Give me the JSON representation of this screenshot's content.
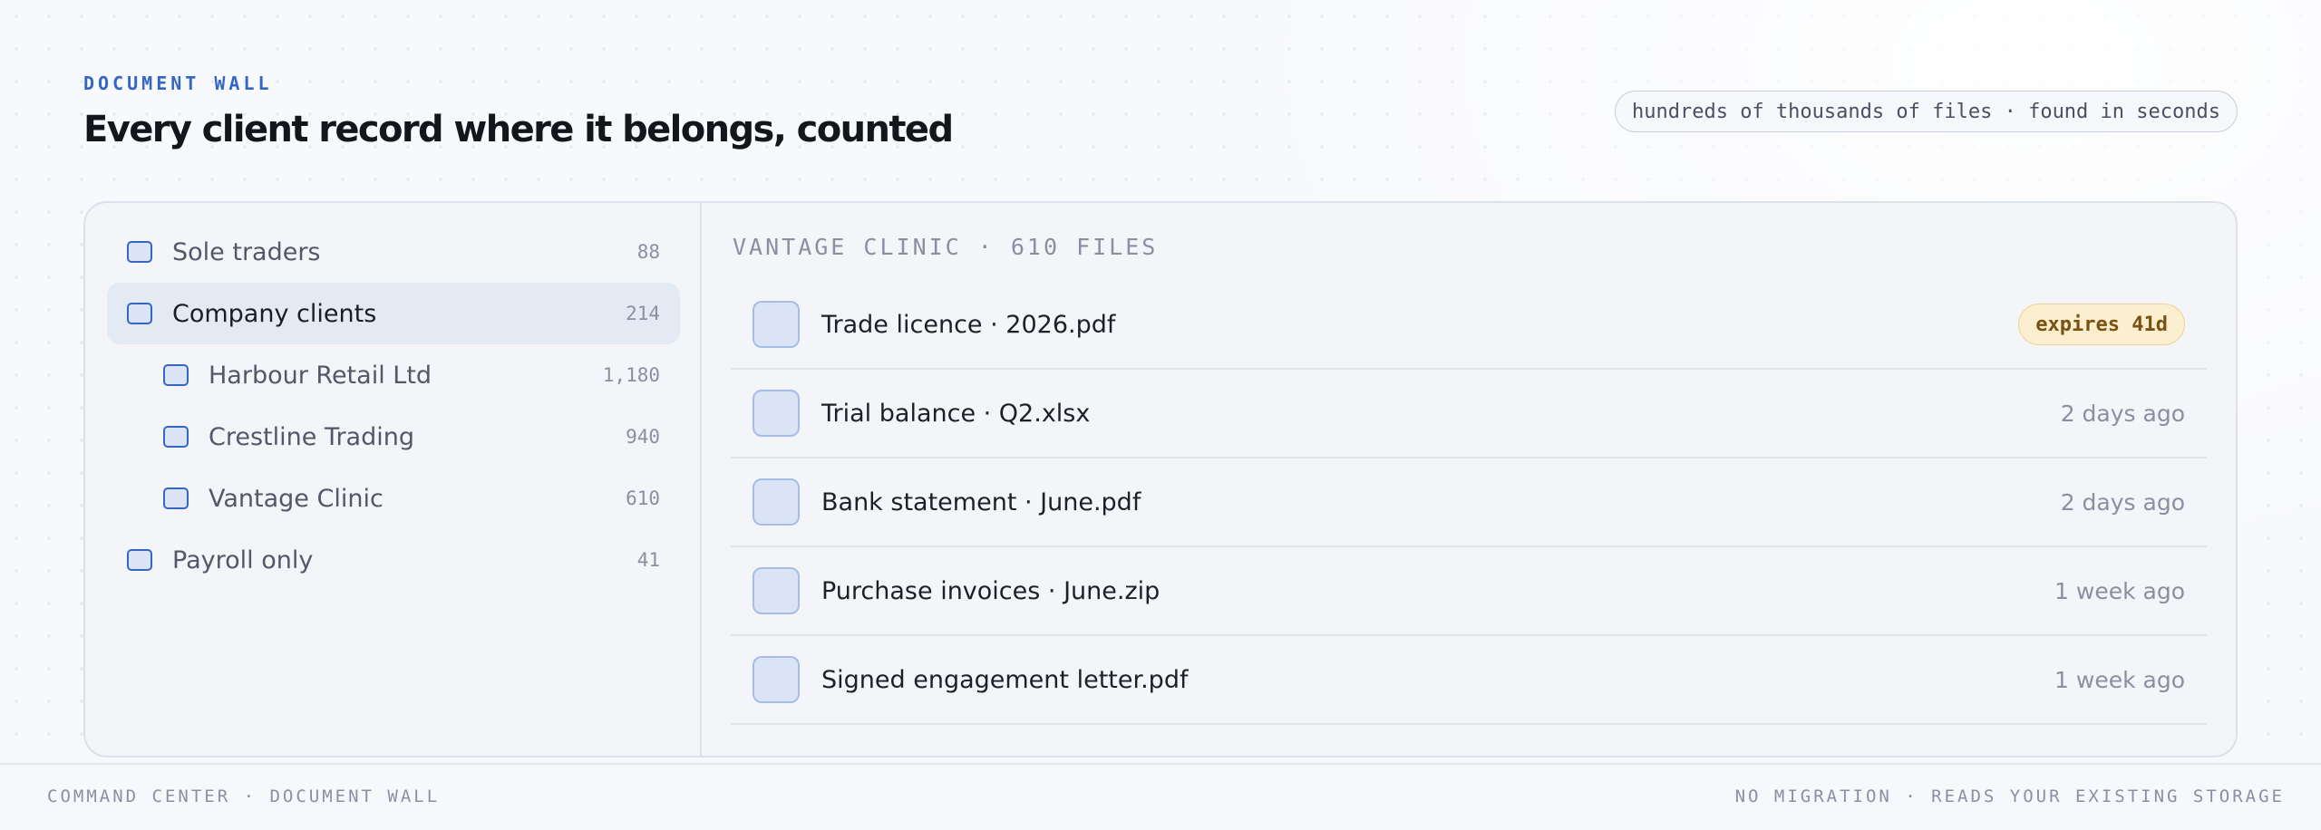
{
  "header": {
    "eyebrow": "DOCUMENT WALL",
    "title": "Every client record where it belongs, counted",
    "pill": "hundreds of thousands of files · found in seconds"
  },
  "tree": [
    {
      "label": "Sole traders",
      "count": "88"
    },
    {
      "label": "Company clients",
      "count": "214"
    },
    {
      "label": "Harbour Retail Ltd",
      "count": "1,180"
    },
    {
      "label": "Crestline Trading",
      "count": "940"
    },
    {
      "label": "Vantage Clinic",
      "count": "610"
    },
    {
      "label": "Payroll only",
      "count": "41"
    }
  ],
  "folder": {
    "heading": "VANTAGE CLINIC · 610 FILES",
    "files": [
      {
        "name": "Trade licence · 2026.pdf",
        "badge": "expires 41d"
      },
      {
        "name": "Trial balance · Q2.xlsx",
        "meta": "2 days ago"
      },
      {
        "name": "Bank statement · June.pdf",
        "meta": "2 days ago"
      },
      {
        "name": "Purchase invoices · June.zip",
        "meta": "1 week ago"
      },
      {
        "name": "Signed engagement letter.pdf",
        "meta": "1 week ago"
      }
    ]
  },
  "footer": {
    "left": "COMMAND CENTER · DOCUMENT WALL",
    "right": "NO MIGRATION · READS YOUR EXISTING STORAGE"
  },
  "colors": {
    "accent": "#3467c4",
    "badge_bg": "#fbefd0",
    "badge_text": "#7a5110"
  }
}
